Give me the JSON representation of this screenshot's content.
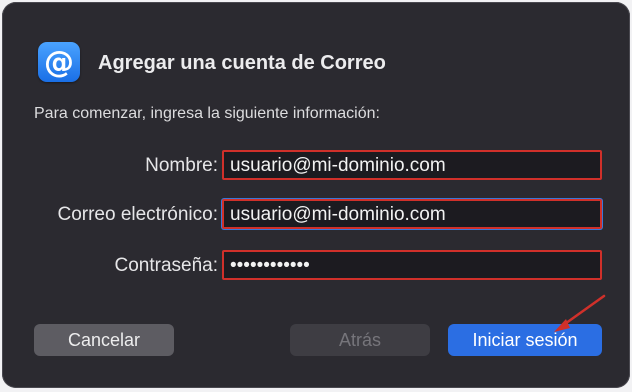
{
  "dialog": {
    "title": "Agregar una cuenta de Correo",
    "icon": "at-sign-icon",
    "subtitle": "Para comenzar, ingresa la siguiente información:"
  },
  "form": {
    "name_label": "Nombre:",
    "name_value": "usuario@mi-dominio.com",
    "email_label": "Correo electrónico:",
    "email_value": "usuario@mi-dominio.com",
    "password_label": "Contraseña:",
    "password_value": "••••••••••••"
  },
  "buttons": {
    "cancel": "Cancelar",
    "back": "Atrás",
    "sign_in": "Iniciar sesión"
  },
  "colors": {
    "highlight_border": "#d0302a",
    "primary_button": "#2b6ee3",
    "annotation_arrow": "#d0302a"
  }
}
